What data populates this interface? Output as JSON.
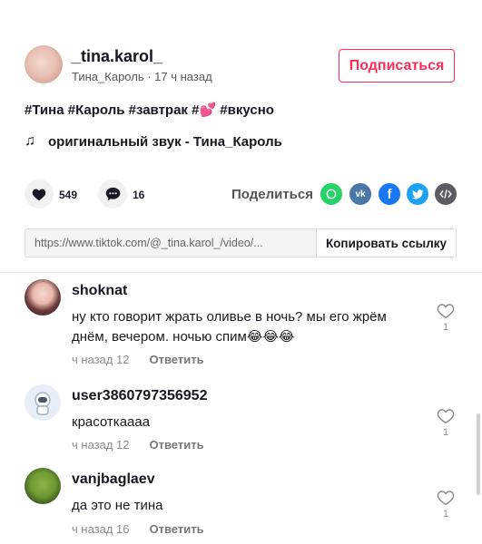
{
  "post": {
    "username": "_tina.karol_",
    "display_name": "Тина_Кароль",
    "separator": " · ",
    "time": "17 ч назад",
    "follow_label": "Подписаться",
    "caption_tags_1": "#Тина #Кароль #завтрак #",
    "caption_emoji": "💕",
    "caption_tags_2": " #вкусно",
    "sound_label": "оригинальный звук - Тина_Кароль"
  },
  "actions": {
    "likes": "549",
    "comments": "16",
    "share_label": "Поделиться",
    "share_icons": [
      "whatsapp-icon",
      "vk-icon",
      "facebook-icon",
      "twitter-icon",
      "embed-icon"
    ]
  },
  "link": {
    "url": "https://www.tiktok.com/@_tina.karol_/video/...",
    "copy_label": "Копировать ссылку"
  },
  "comments": [
    {
      "name": "shoknat",
      "text": "ну кто говорит жрать оливье в ночь? мы его жрём днём, вечером. ночью спим😂😂😂",
      "time": "ч назад 12",
      "reply": "Ответить",
      "likes": "1"
    },
    {
      "name": "user3860797356952",
      "text": "красоткаааа",
      "time": "ч назад 12",
      "reply": "Ответить",
      "likes": "1"
    },
    {
      "name": "vanjbaglaev",
      "text": "да это не тина",
      "time": "ч назад 16",
      "reply": "Ответить",
      "likes": "1"
    }
  ],
  "colors": {
    "accent": "#fe2c55",
    "whatsapp": "#25d366",
    "vk": "#4a76a8",
    "facebook": "#1877f2",
    "twitter": "#1da1f2",
    "embed": "#5b5d63"
  }
}
